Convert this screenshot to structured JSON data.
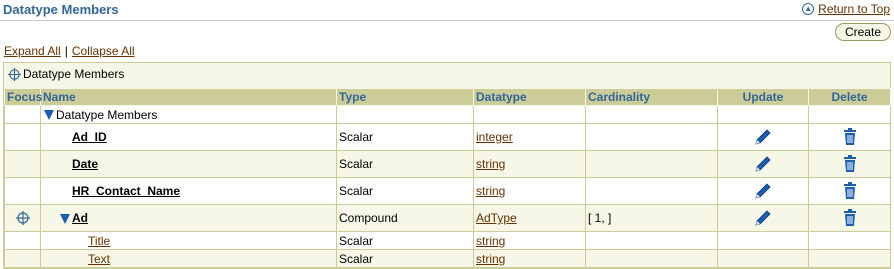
{
  "header": {
    "title": "Datatype Members",
    "return_label": "Return to Top"
  },
  "toolbar": {
    "create_label": "Create"
  },
  "expand": {
    "expand_all": "Expand All",
    "separator": "|",
    "collapse_all": "Collapse All"
  },
  "crumb": {
    "label": "Datatype Members"
  },
  "table": {
    "headers": {
      "focus": "Focus",
      "name": "Name",
      "type": "Type",
      "datatype": "Datatype",
      "cardinality": "Cardinality",
      "update": "Update",
      "delete": "Delete"
    },
    "rows": [
      {
        "name": "Datatype Members",
        "type": "",
        "datatype": "",
        "cardinality": ""
      },
      {
        "name": "Ad_ID",
        "type": "Scalar",
        "datatype": "integer",
        "cardinality": ""
      },
      {
        "name": "Date",
        "type": "Scalar",
        "datatype": "string",
        "cardinality": ""
      },
      {
        "name": "HR_Contact_Name",
        "type": "Scalar",
        "datatype": "string",
        "cardinality": ""
      },
      {
        "name": "Ad",
        "type": "Compound",
        "datatype": "AdType",
        "cardinality": "[ 1, ]"
      },
      {
        "name": "Title",
        "type": "Scalar",
        "datatype": "string",
        "cardinality": ""
      },
      {
        "name": "Text",
        "type": "Scalar",
        "datatype": "string",
        "cardinality": ""
      }
    ]
  },
  "colors": {
    "title": "#336699",
    "link": "#663300",
    "header_bg": "#cccc99",
    "alt_row": "#f7f7e7",
    "icon_blue": "#1b5fb4"
  }
}
